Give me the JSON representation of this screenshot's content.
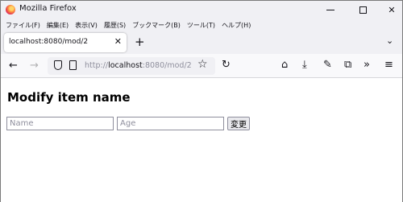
{
  "window": {
    "title": "Mozilla Firefox"
  },
  "menubar": {
    "items": [
      "ファイル(F)",
      "編集(E)",
      "表示(V)",
      "履歴(S)",
      "ブックマーク(B)",
      "ツール(T)",
      "ヘルプ(H)"
    ]
  },
  "tab": {
    "label": "localhost:8080/mod/2"
  },
  "address": {
    "scheme": "http://",
    "host": "localhost",
    "rest": ":8080/mod/2"
  },
  "page": {
    "heading": "Modify item name",
    "name_placeholder": "Name",
    "age_placeholder": "Age",
    "submit_label": "変更"
  },
  "icons": {
    "app": "firefox-logo-icon",
    "minimize": "minimize-icon",
    "maximize": "maximize-icon",
    "close": "close-icon",
    "tab_close": "close-icon",
    "new_tab": "plus-icon",
    "tab_list": "chevron-down-icon",
    "back": "arrow-left-icon",
    "forward": "arrow-right-icon",
    "tracking": "shield-icon",
    "page_info": "page-icon",
    "bookmark": "star-icon",
    "reload": "reload-icon",
    "home": "home-icon",
    "downloads": "download-icon",
    "tools": "wrench-icon",
    "extensions": "puzzle-icon",
    "overflow": "double-chevron-icon",
    "menu": "hamburger-menu-icon"
  }
}
